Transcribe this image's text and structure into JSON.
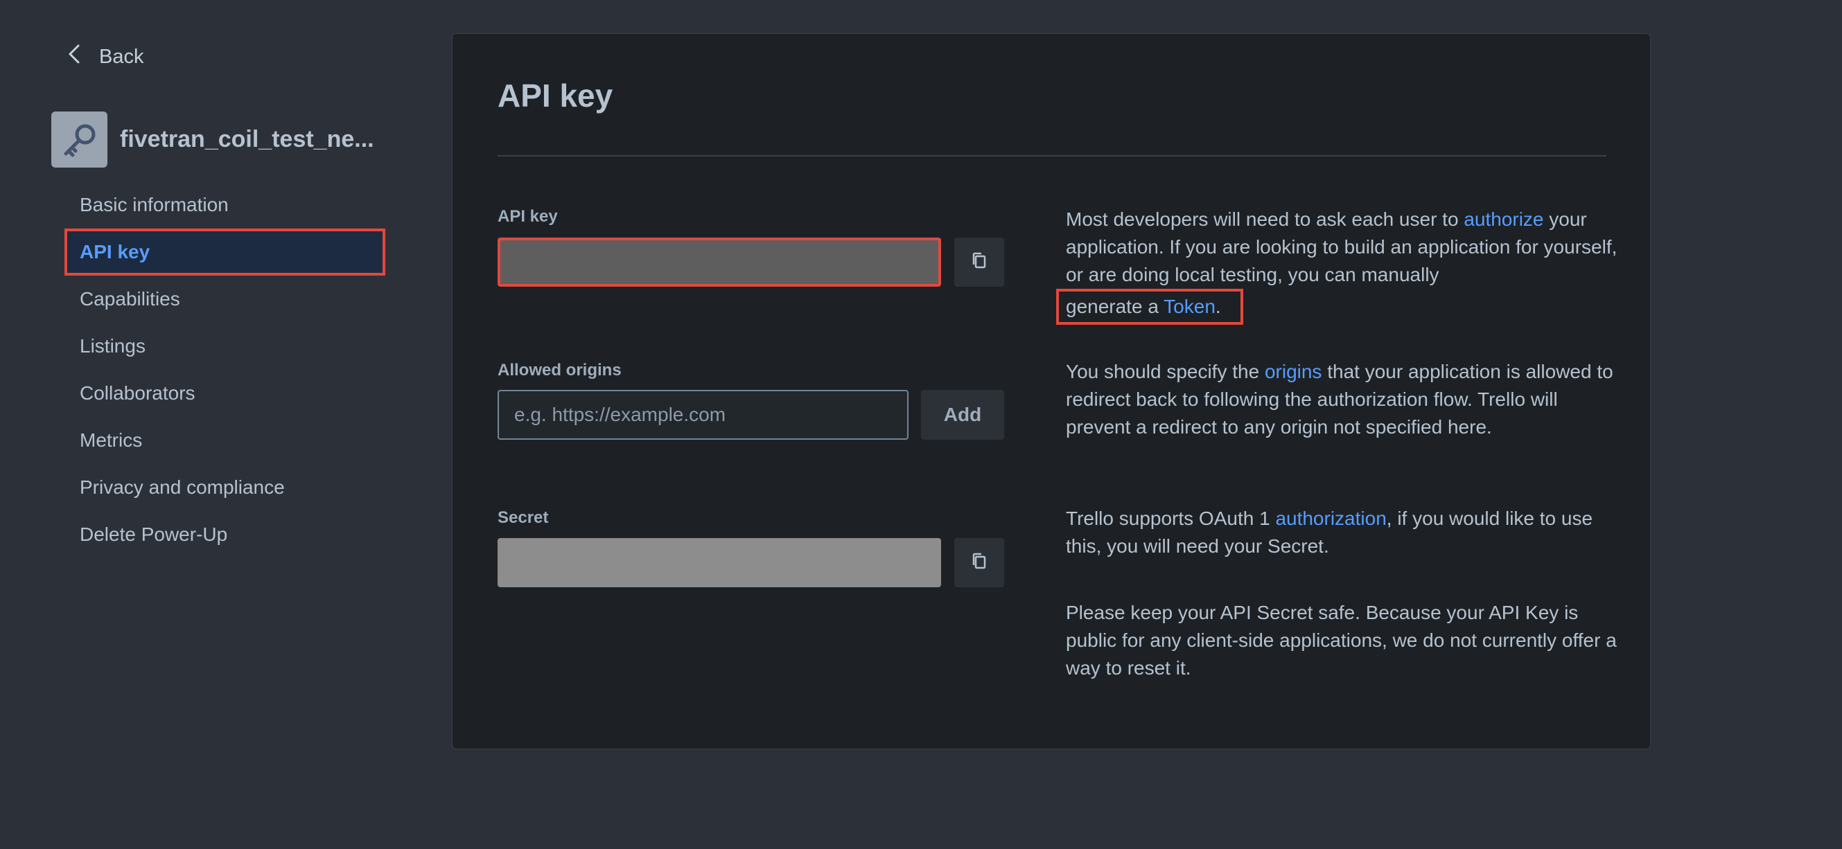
{
  "sidebar": {
    "back_label": "Back",
    "app_name": "fivetran_coil_test_ne...",
    "items": [
      {
        "label": "Basic information",
        "active": false
      },
      {
        "label": "API key",
        "active": true
      },
      {
        "label": "Capabilities",
        "active": false
      },
      {
        "label": "Listings",
        "active": false
      },
      {
        "label": "Collaborators",
        "active": false
      },
      {
        "label": "Metrics",
        "active": false
      },
      {
        "label": "Privacy and compliance",
        "active": false
      },
      {
        "label": "Delete Power-Up",
        "active": false
      }
    ]
  },
  "main": {
    "title": "API key",
    "api_key": {
      "label": "API key",
      "value": ""
    },
    "allowed_origins": {
      "label": "Allowed origins",
      "placeholder": "e.g. https://example.com",
      "value": "",
      "add_label": "Add"
    },
    "secret": {
      "label": "Secret",
      "value": ""
    },
    "descriptions": {
      "api_key": {
        "part1": "Most developers will need to ask each user to ",
        "link1": "authorize",
        "part2": " your application. If you are looking to build an application for yourself, or are doing local testing, you can manually ",
        "part3": "generate a ",
        "link2": "Token",
        "part4": "."
      },
      "origins": {
        "part1": "You should specify the ",
        "link": "origins",
        "part2": " that your application is allowed to redirect back to following the authorization flow. Trello will prevent a redirect to any origin not specified here."
      },
      "secret": {
        "part1": "Trello supports OAuth 1 ",
        "link": "authorization",
        "part2": ", if you would like to use this, you will need your Secret."
      },
      "secret_warning": "Please keep your API Secret safe. Because your API Key is public for any client-side applications, we do not currently offer a way to reset it."
    }
  },
  "icons": {
    "back": "chevron-left-icon",
    "app": "key-icon",
    "copy": "copy-icon"
  },
  "colors": {
    "background": "#2c3139",
    "panel": "#1d2125",
    "link": "#579dff",
    "highlight": "#e2483d",
    "active_bg": "#1c2b41"
  }
}
